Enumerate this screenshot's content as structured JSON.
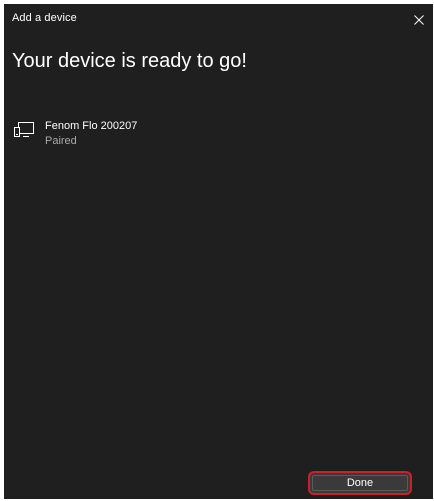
{
  "window": {
    "title": "Add a device"
  },
  "main": {
    "heading": "Your device is ready to go!",
    "device": {
      "name": "Fenom Flo 200207",
      "status": "Paired",
      "icon": "device-display-icon"
    }
  },
  "footer": {
    "done_label": "Done"
  },
  "colors": {
    "background": "#1f1f1f",
    "button": "#3a3a3a",
    "highlight": "#cc1f2a",
    "secondary_text": "#a8a8a8"
  }
}
